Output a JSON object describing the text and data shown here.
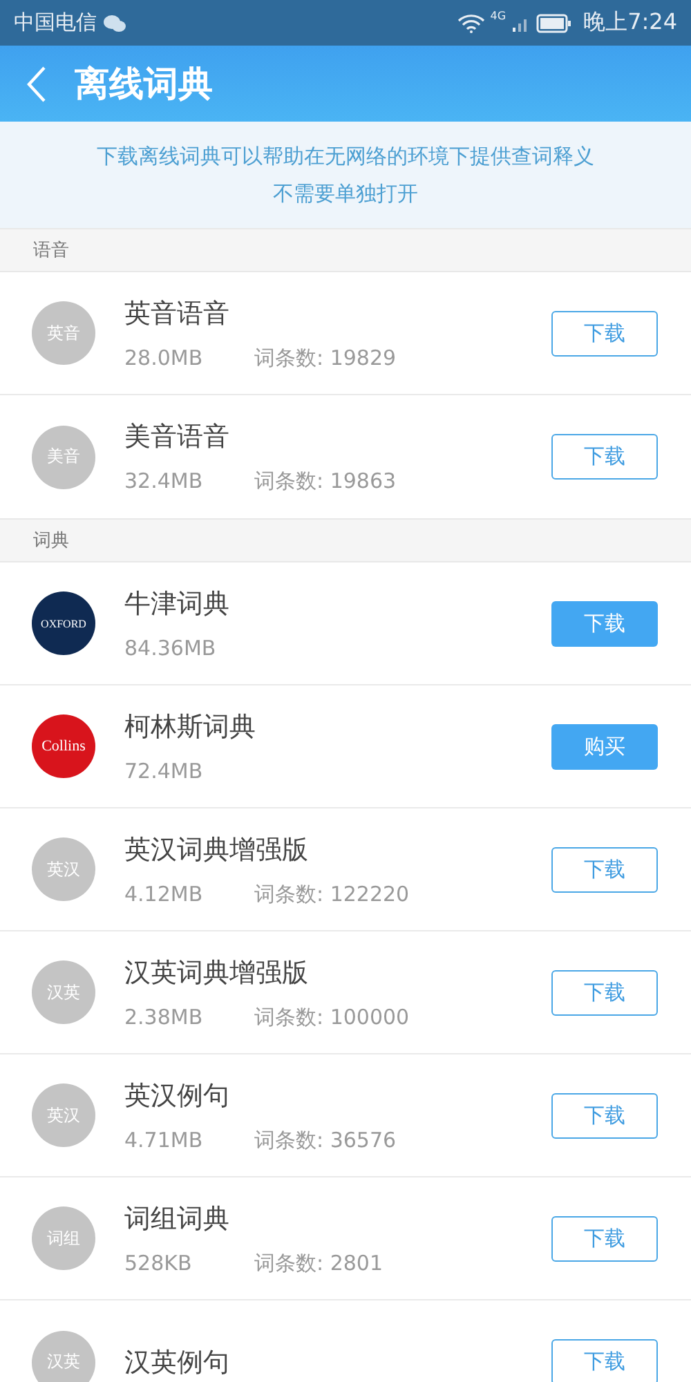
{
  "status_bar": {
    "carrier": "中国电信",
    "network": "4G",
    "time": "晚上7:24"
  },
  "header": {
    "title": "离线词典"
  },
  "notice": {
    "lines": [
      "下载离线词典可以帮助在无网络的环境下提供查词释义",
      "不需要单独打开"
    ]
  },
  "sections": [
    {
      "title": "语音",
      "items": [
        {
          "avatar": {
            "kind": "text",
            "text": "英音"
          },
          "name": "英音语音",
          "size": "28.0MB",
          "count": "词条数: 19829",
          "action": {
            "label": "下载",
            "kind": "outline"
          }
        },
        {
          "avatar": {
            "kind": "text",
            "text": "美音"
          },
          "name": "美音语音",
          "size": "32.4MB",
          "count": "词条数: 19863",
          "action": {
            "label": "下载",
            "kind": "outline"
          }
        }
      ]
    },
    {
      "title": "词典",
      "items": [
        {
          "avatar": {
            "kind": "oxford",
            "text": "OXFORD"
          },
          "name": "牛津词典",
          "size": "84.36MB",
          "action": {
            "label": "下载",
            "kind": "filled"
          }
        },
        {
          "avatar": {
            "kind": "collins",
            "text": "Collins"
          },
          "name": "柯林斯词典",
          "size": "72.4MB",
          "action": {
            "label": "购买",
            "kind": "filled"
          }
        },
        {
          "avatar": {
            "kind": "text",
            "text": "英汉"
          },
          "name": "英汉词典增强版",
          "size": "4.12MB",
          "count": "词条数: 122220",
          "action": {
            "label": "下载",
            "kind": "outline"
          }
        },
        {
          "avatar": {
            "kind": "text",
            "text": "汉英"
          },
          "name": "汉英词典增强版",
          "size": "2.38MB",
          "count": "词条数: 100000",
          "action": {
            "label": "下载",
            "kind": "outline"
          }
        },
        {
          "avatar": {
            "kind": "text",
            "text": "英汉"
          },
          "name": "英汉例句",
          "size": "4.71MB",
          "count": "词条数: 36576",
          "action": {
            "label": "下载",
            "kind": "outline"
          }
        },
        {
          "avatar": {
            "kind": "text",
            "text": "词组"
          },
          "name": "词组词典",
          "size": "528KB",
          "count": "词条数: 2801",
          "action": {
            "label": "下载",
            "kind": "outline"
          }
        },
        {
          "avatar": {
            "kind": "text",
            "text": "汉英"
          },
          "name": "汉英例句",
          "action": {
            "label": "下载",
            "kind": "outline"
          }
        }
      ]
    }
  ]
}
